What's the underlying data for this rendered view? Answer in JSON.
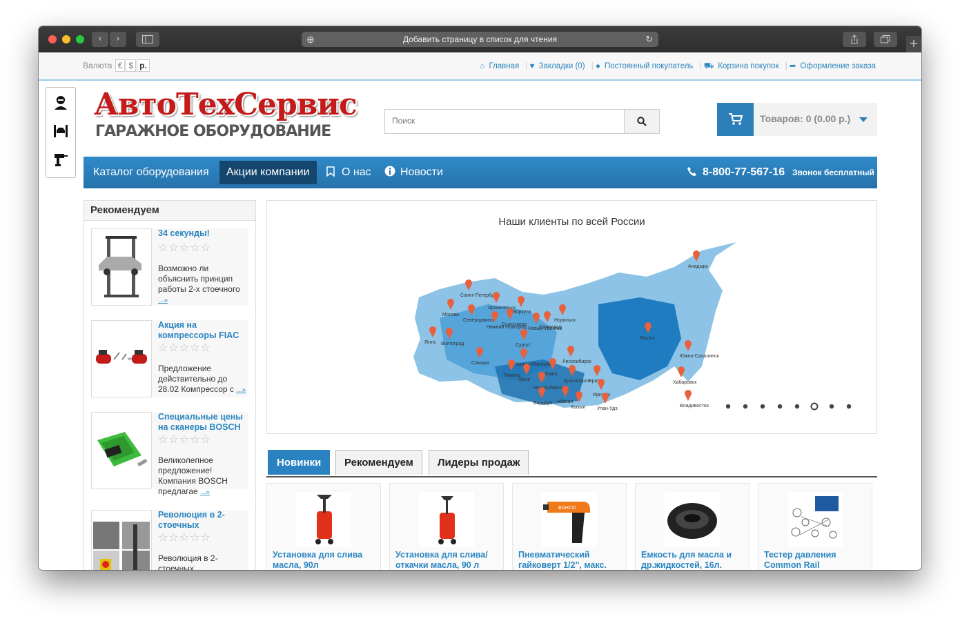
{
  "browser": {
    "address_text": "Добавить страницу в список для чтения"
  },
  "topbar": {
    "currency_label": "Валюта",
    "currencies": [
      "€",
      "$",
      "р."
    ],
    "links": [
      {
        "label": "Главная",
        "icon": "home-icon"
      },
      {
        "label": "Закладки (0)",
        "icon": "heart-icon"
      },
      {
        "label": "Постоянный покупатель",
        "icon": "user-icon"
      },
      {
        "label": "Корзина покупок",
        "icon": "cart-icon"
      },
      {
        "label": "Оформление заказа",
        "icon": "share-icon"
      }
    ]
  },
  "logo": {
    "line1": "АвтоТехСервис",
    "line2": "ГАРАЖНОЕ ОБОРУДОВАНИЕ"
  },
  "search": {
    "placeholder": "Поиск"
  },
  "cart": {
    "label": "Товаров: 0 (0.00 р.)"
  },
  "nav": {
    "items": [
      "Каталог оборудования",
      "Акции компании",
      "О нас",
      "Новости"
    ],
    "phone": "8-800-77-567-16",
    "phone_note": "Звонок бесплатный"
  },
  "recommend": {
    "title": "Рекомендуем",
    "items": [
      {
        "title": "34 секунды!",
        "desc": "Возможно ли объяснить принцип работы 2-х стоечного",
        "more": "...»"
      },
      {
        "title": "Акция на компрессоры FIAC",
        "desc": "Предложение действительно до 28.02 Компрессор с",
        "more": "...»"
      },
      {
        "title": "Специальные цены на сканеры BOSCH",
        "desc": "Великолепное предложение! Компания BOSCH предлагае",
        "more": "...»"
      },
      {
        "title": "Революция в 2-стоечных",
        "desc": "Революция в 2-стоечных",
        "more": ""
      }
    ]
  },
  "map": {
    "title": "Наши клиенты по всей России",
    "cities": [
      "Анадырь",
      "Санкт-Петербург",
      "Архангельск",
      "Москва",
      "Воркута",
      "Северодвинск",
      "Сыктывкар",
      "Нижний Новгород",
      "Норильск",
      "Салехард",
      "Новый Уренгой",
      "Ялта",
      "Волгоград",
      "Сургут",
      "Якутск",
      "Лесосибирск",
      "Ханты-Мансийск",
      "Самара",
      "Тюмень",
      "Томск",
      "Омск",
      "Красноярск",
      "Братск",
      "Новосибирск",
      "Иркутск",
      "Барнаул",
      "Абакан",
      "Кызыл",
      "Улан-Удэ",
      "Южно-Сахалинск",
      "Хабаровск",
      "Владивосток"
    ],
    "slide_count": 8,
    "active_slide": 6
  },
  "tabs": [
    "Новинки",
    "Рекомендуем",
    "Лидеры продаж"
  ],
  "products": [
    {
      "title": "Установка для слива масла, 90л"
    },
    {
      "title": "Установка для слива/откачки масла, 90 л"
    },
    {
      "title": "Пневматический гайковерт 1/2\", макс."
    },
    {
      "title": "Емкость для масла и др.жидкостей, 16л."
    },
    {
      "title": "Тестер давления Common Rail"
    }
  ],
  "colors": {
    "accent": "#2d7fb9",
    "nav_active": "#14466e",
    "logo_red": "#c41a1a"
  }
}
